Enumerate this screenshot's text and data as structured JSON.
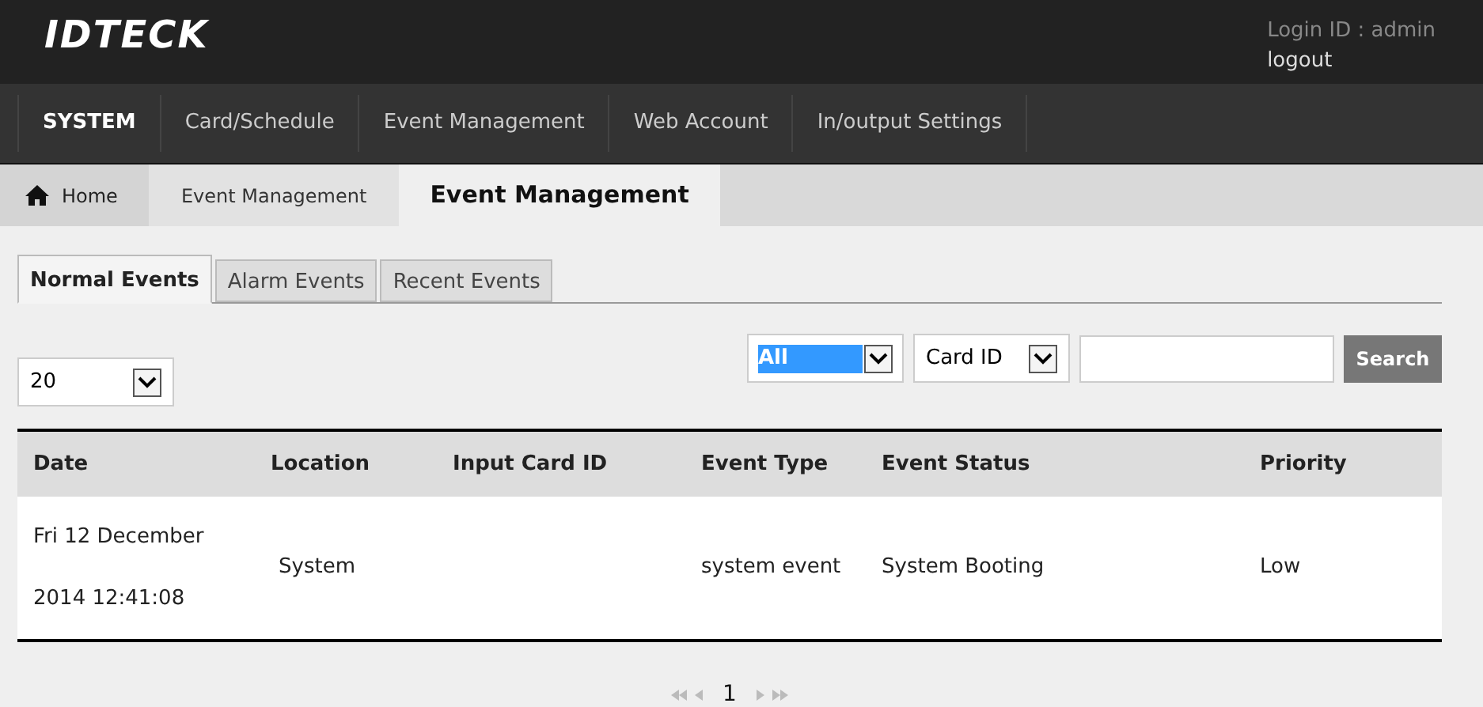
{
  "header": {
    "logo": "IDTECK",
    "login_id": "Login ID : admin",
    "logout": "logout"
  },
  "nav": [
    {
      "label": "SYSTEM",
      "selected": true
    },
    {
      "label": "Card/Schedule",
      "selected": false
    },
    {
      "label": "Event Management",
      "selected": false
    },
    {
      "label": "Web Account",
      "selected": false
    },
    {
      "label": "In/output Settings",
      "selected": false
    }
  ],
  "breadcrumb": {
    "home": "Home",
    "section": "Event Management",
    "current": "Event Management"
  },
  "tabs": [
    {
      "label": "Normal Events",
      "selected": true
    },
    {
      "label": "Alarm Events",
      "selected": false
    },
    {
      "label": "Recent Events",
      "selected": false
    }
  ],
  "page_size": "20",
  "filter": {
    "type": "All",
    "field": "Card ID",
    "search_button": "Search"
  },
  "table": {
    "columns": [
      "Date",
      "Location",
      "Input Card ID",
      "Event Type",
      "Event Status",
      "Priority"
    ],
    "rows": [
      [
        "Fri 12 December\n\n2014 12:41:08",
        "System",
        "",
        "system event",
        "System Booting",
        "Low"
      ]
    ]
  },
  "pagination": {
    "current": "1"
  }
}
